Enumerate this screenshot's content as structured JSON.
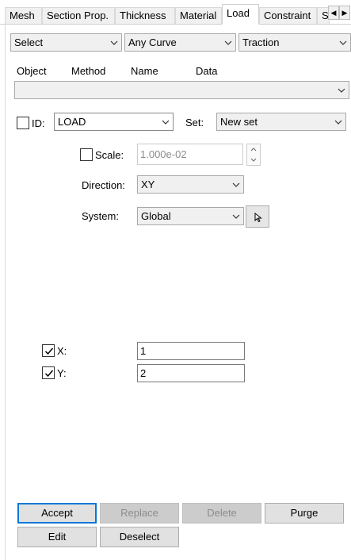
{
  "tabs": [
    {
      "label": "Mesh",
      "active": false
    },
    {
      "label": "Section Prop.",
      "active": false
    },
    {
      "label": "Thickness",
      "active": false
    },
    {
      "label": "Material",
      "active": false
    },
    {
      "label": "Load",
      "active": true
    },
    {
      "label": "Constraint",
      "active": false
    },
    {
      "label": "S",
      "active": false
    }
  ],
  "top_selectors": {
    "action": "Select",
    "curve": "Any Curve",
    "load_type": "Traction"
  },
  "list_headers": [
    "Object",
    "Method",
    "Name",
    "Data"
  ],
  "list_value": "",
  "id_row": {
    "id_label": "ID:",
    "id_checked": false,
    "id_value": "LOAD",
    "set_label": "Set:",
    "set_value": "New set"
  },
  "scale": {
    "label": "Scale:",
    "checked": false,
    "value": "1.000e-02"
  },
  "direction": {
    "label": "Direction:",
    "value": "XY"
  },
  "system": {
    "label": "System:",
    "value": "Global"
  },
  "components": [
    {
      "label": "X:",
      "checked": true,
      "value": "1"
    },
    {
      "label": "Y:",
      "checked": true,
      "value": "2"
    }
  ],
  "buttons": {
    "accept": "Accept",
    "replace": "Replace",
    "delete": "Delete",
    "purge": "Purge",
    "edit": "Edit",
    "deselect": "Deselect"
  }
}
